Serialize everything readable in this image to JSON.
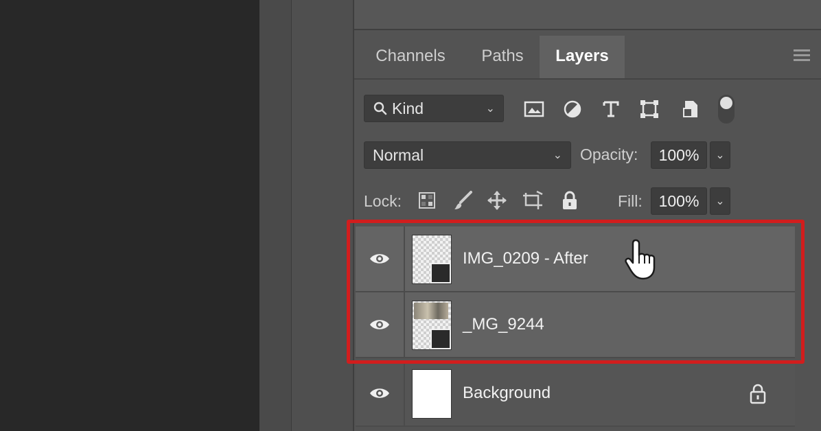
{
  "tabs": [
    {
      "label": "Channels",
      "active": false
    },
    {
      "label": "Paths",
      "active": false
    },
    {
      "label": "Layers",
      "active": true
    }
  ],
  "filter": {
    "kind_label": "Kind",
    "filter_icons": [
      "image-filter-icon",
      "adjustment-filter-icon",
      "type-filter-icon",
      "shape-filter-icon",
      "smart-object-filter-icon"
    ]
  },
  "blend": {
    "mode": "Normal",
    "opacity_label": "Opacity:",
    "opacity_value": "100%"
  },
  "lock": {
    "label": "Lock:",
    "icons": [
      "lock-transparent-icon",
      "lock-image-icon",
      "lock-position-icon",
      "lock-artboard-icon",
      "lock-all-icon"
    ],
    "fill_label": "Fill:",
    "fill_value": "100%"
  },
  "layers": [
    {
      "name": "IMG_0209 - After",
      "visible": true,
      "smart_object": true,
      "thumb": "transparent"
    },
    {
      "name": "_MG_9244",
      "visible": true,
      "smart_object": true,
      "thumb": "photo"
    },
    {
      "name": "Background",
      "visible": true,
      "locked": true,
      "thumb": "white"
    }
  ],
  "highlight_color": "#d21d1d"
}
